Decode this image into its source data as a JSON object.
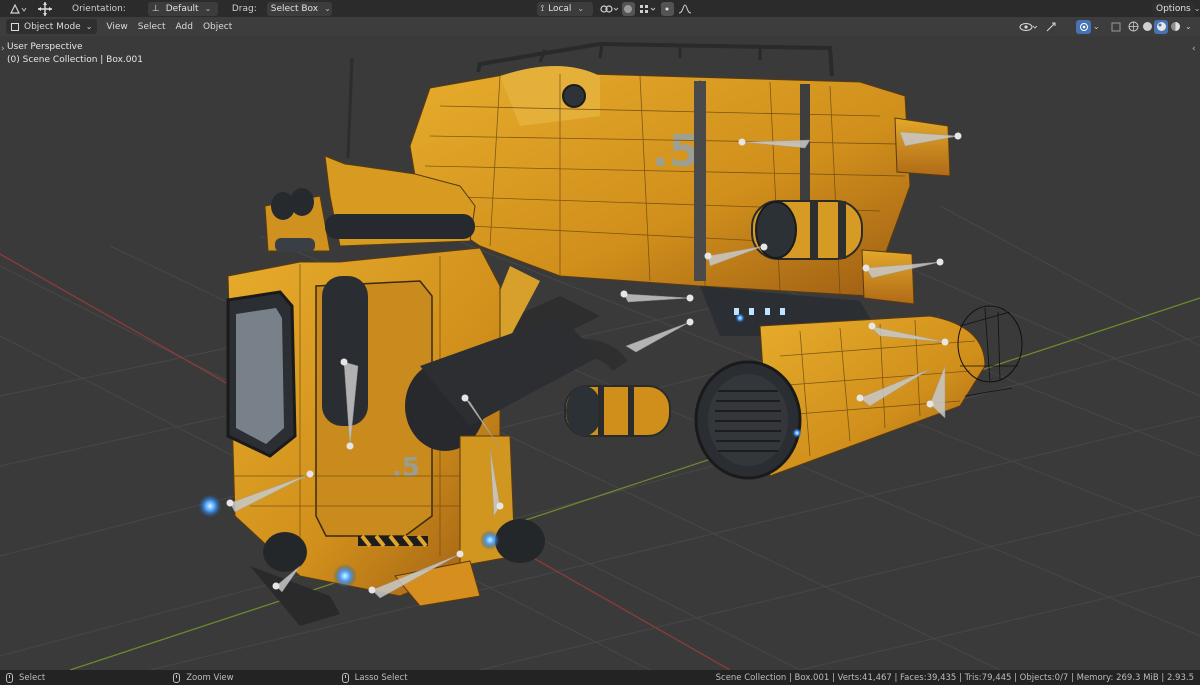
{
  "topbar": {
    "orientation_label": "Orientation:",
    "orientation_value": "Default",
    "drag_label": "Drag:",
    "drag_value": "Select Box",
    "pivot_value": "Local",
    "options_label": "Options",
    "icons": [
      "transform-pivot-icon",
      "move-gizmo-icon",
      "snap-icon",
      "proportional-edit-icon"
    ]
  },
  "header": {
    "mode": "Object Mode",
    "menus": [
      "View",
      "Select",
      "Add",
      "Object"
    ],
    "shading_modes": [
      "wireframe",
      "solid",
      "material",
      "rendered"
    ]
  },
  "viewport": {
    "view_name": "User Perspective",
    "collection_path": "(0) Scene Collection | Box.001",
    "background_color": "#3a3a3a",
    "grid_color": "#474747",
    "x_axis_color": "#8c3b3b",
    "y_axis_color": "#6d8a2c",
    "model_color": "#d99a21"
  },
  "statusbar": {
    "left_action": "Select",
    "middle_action": "Zoom View",
    "right_action": "Lasso Select",
    "stats": "Scene Collection | Box.001 | Verts:41,467 | Faces:39,435 | Tris:79,445 | Objects:0/7 | Memory: 269.3 MiB | 2.93.5"
  }
}
